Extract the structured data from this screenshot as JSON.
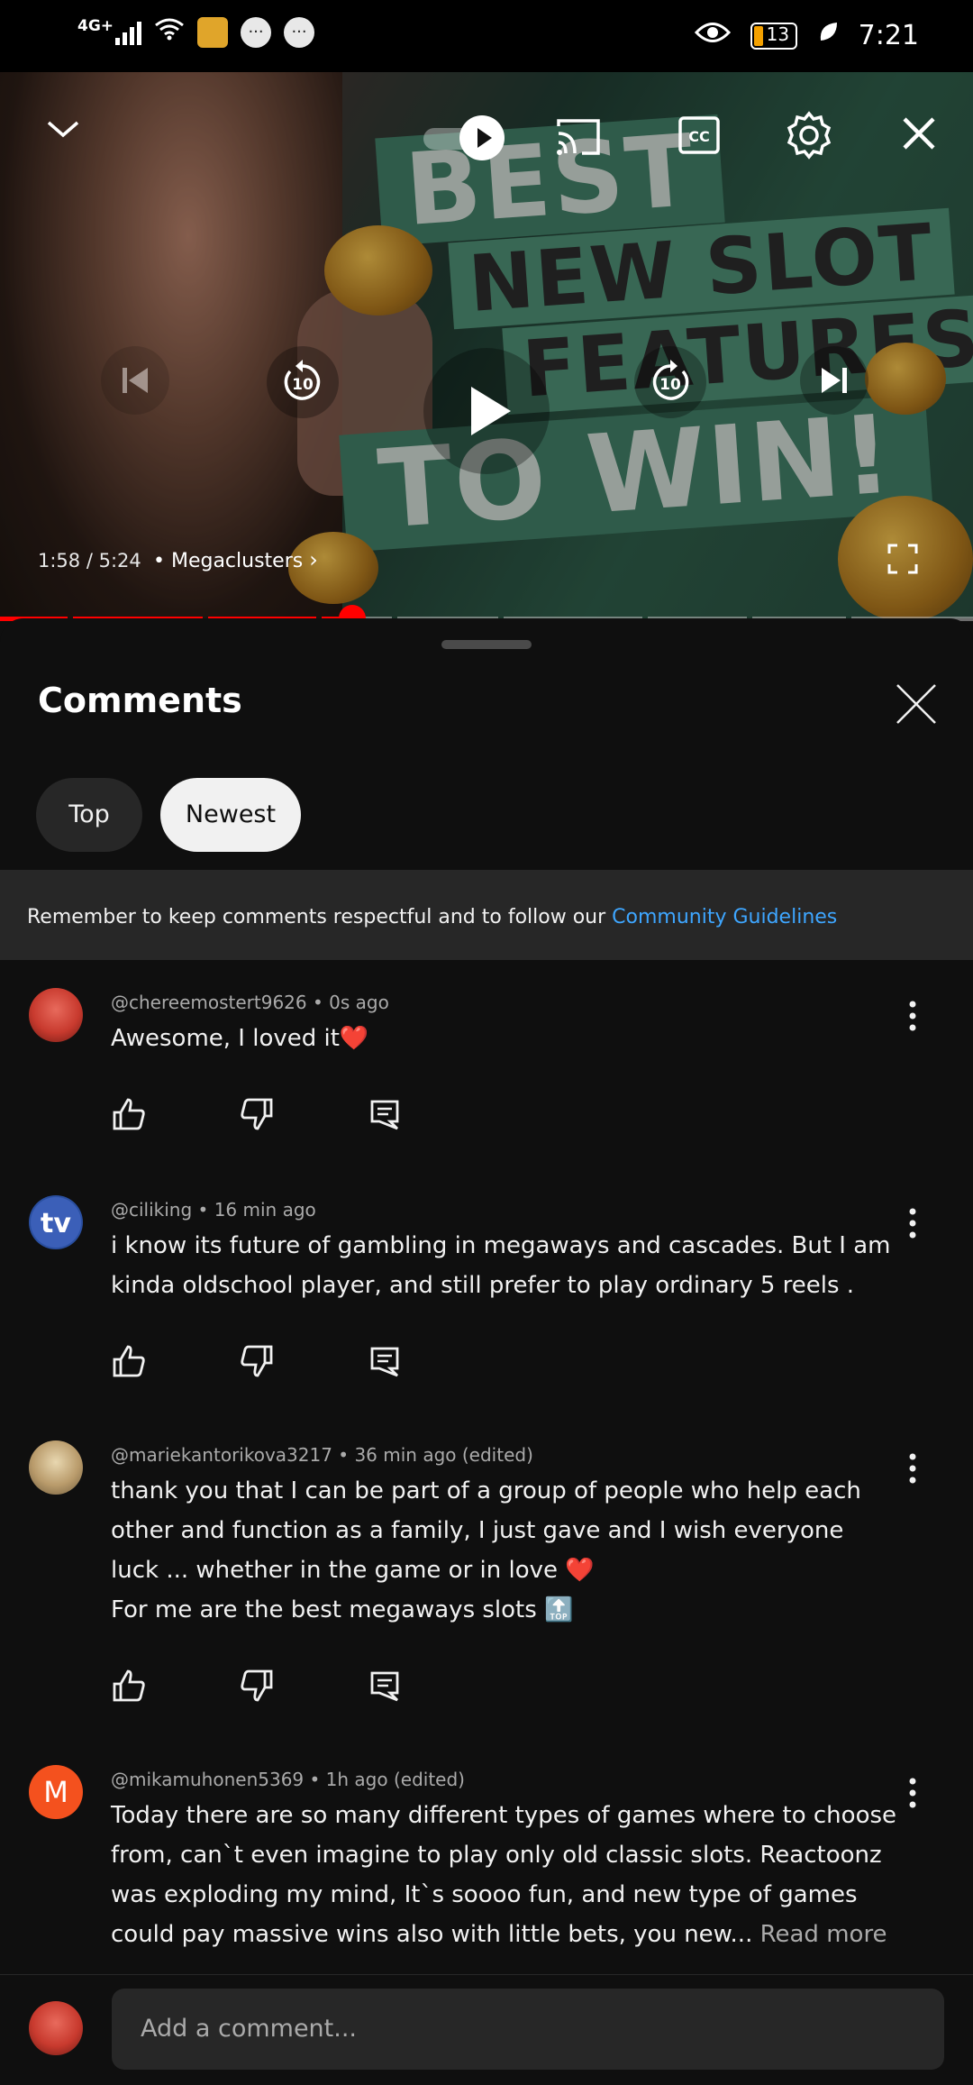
{
  "status_bar": {
    "network": "4G+",
    "battery_level": "13",
    "time": "7:21"
  },
  "player": {
    "time_current": "1:58",
    "time_separator": "/",
    "time_total": "5:24",
    "chapter": "• Megaclusters",
    "thumbnail_text": [
      "BEST",
      "NEW SLOT",
      "FEATURES",
      "TO WIN!"
    ],
    "progress_fraction": 0.362,
    "rewind_seconds": "10",
    "forward_seconds": "10"
  },
  "comments": {
    "title": "Comments",
    "filters": [
      {
        "label": "Top",
        "selected": false
      },
      {
        "label": "Newest",
        "selected": true
      }
    ],
    "notice_text": "Remember to keep comments respectful and to follow our",
    "notice_link": "Community Guidelines",
    "items": [
      {
        "handle": "@chereemostert9626 • 0s ago",
        "lines": [
          "Awesome, I loved it❤️"
        ]
      },
      {
        "handle": "@ciliking • 16 min ago",
        "lines": [
          "i know its future of gambling in megaways and cascades. But I am",
          "kinda oldschool player, and still prefer to play ordinary 5 reels ."
        ]
      },
      {
        "handle": "@mariekantorikova3217 • 36 min ago (edited)",
        "lines": [
          "thank you that I can be part of a group of people who help each",
          "other and function as a family, I just gave and I wish everyone",
          "luck ... whether in the game or in love ❤️",
          "For me are the best megaways slots 🔝"
        ]
      },
      {
        "handle": "@mikamuhonen5369 • 1h ago (edited)",
        "avatar_letter": "M",
        "lines": [
          "Today there are so many different types of games where to choose",
          "from, can`t even imagine to play only old classic slots. Reactoonz",
          "was exploding my mind, It`s soooo fun, and new type of games",
          "could pay massive wins also with little bets, you new..."
        ],
        "read_more": "Read more"
      }
    ],
    "add_comment_placeholder": "Add a comment..."
  },
  "colors": {
    "background": "#0f0f0f",
    "progress": "#ff0000",
    "link": "#3ea6ff",
    "chip_selected": "#f1f1f1",
    "avatar_m": "#f4511e"
  }
}
